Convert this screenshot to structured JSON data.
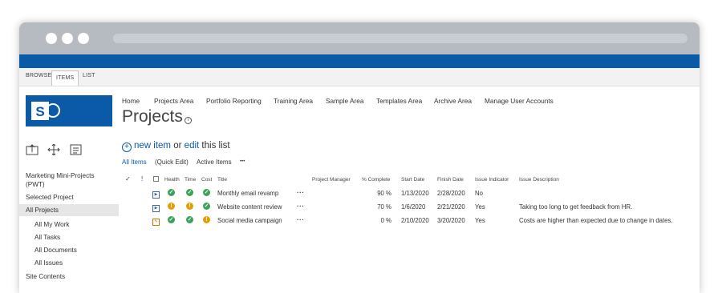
{
  "ribbon": {
    "tabs": [
      "BROWSE",
      "ITEMS",
      "LIST"
    ]
  },
  "topnav": [
    "Home",
    "Projects Area",
    "Portfolio Reporting",
    "Training Area",
    "Sample Area",
    "Templates Area",
    "Archive Area",
    "Manage User Accounts"
  ],
  "page_title": "Projects",
  "toolbar_icons": [
    "share-icon",
    "move-icon",
    "list-icon"
  ],
  "leftnav": {
    "items": [
      {
        "label": "Marketing Mini-Projects (PWT)"
      },
      {
        "label": "Selected Project"
      },
      {
        "label": "All Projects"
      },
      {
        "label": "All My Work"
      },
      {
        "label": "All Tasks"
      },
      {
        "label": "All Documents"
      },
      {
        "label": "All Issues"
      },
      {
        "label": "Site Contents"
      }
    ]
  },
  "newitem": {
    "new_label": "new item",
    "or": "or",
    "edit_label": "edit",
    "this_list": "this list"
  },
  "views": [
    "All Items",
    "(Quick Edit)",
    "Active Items",
    "•••"
  ],
  "columns": {
    "check": "✓",
    "excl": "!",
    "health": "Health",
    "time": "Time",
    "cost": "Cost",
    "title": "Title",
    "pm": "Project Manager",
    "pct": "% Complete",
    "start": "Start Date",
    "finish": "Finish Date",
    "issue": "Issue Indicator",
    "desc": "Issue Description"
  },
  "rows": [
    {
      "title": "Monthly email revamp",
      "pct": "90 %",
      "start": "1/13/2020",
      "finish": "2/28/2020",
      "issue": "No",
      "desc": "",
      "health": "ok",
      "time": "ok",
      "cost": "ok"
    },
    {
      "title": "Website content review",
      "pct": "70 %",
      "start": "1/6/2020",
      "finish": "2/21/2020",
      "issue": "Yes",
      "desc": "Taking too long to get feedback from HR.",
      "health": "warn",
      "time": "warn",
      "cost": "ok"
    },
    {
      "title": "Social media campaign",
      "pct": "0 %",
      "start": "2/10/2020",
      "finish": "3/20/2020",
      "issue": "Yes",
      "desc": "Costs are higher than expected due to change in dates.",
      "health": "ok",
      "time": "ok",
      "cost": "warn"
    }
  ],
  "colors": {
    "brand": "#0a5aa8",
    "ok": "#3aa35a",
    "warn": "#e0a100"
  }
}
